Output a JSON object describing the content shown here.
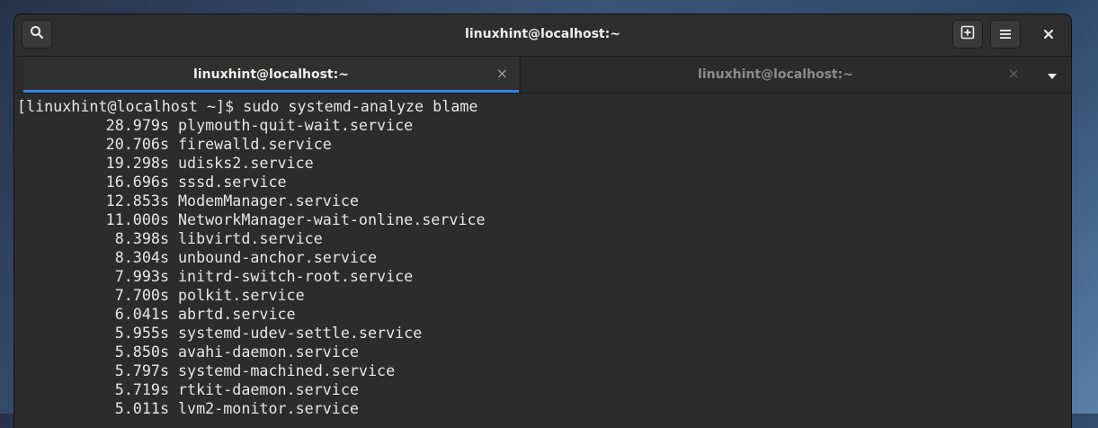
{
  "window": {
    "title": "linuxhint@localhost:~"
  },
  "headerbar": {
    "search_icon": "search-icon",
    "new_tab_icon": "new-tab-icon",
    "menu_icon": "hamburger-menu-icon",
    "close_icon": "close-icon"
  },
  "tabs": [
    {
      "label": "linuxhint@localhost:~",
      "active": true,
      "close": "×"
    },
    {
      "label": "linuxhint@localhost:~",
      "active": false,
      "close": "×"
    }
  ],
  "tab_menu_icon": "chevron-down-icon",
  "terminal": {
    "prompt": "[linuxhint@localhost ~]$ sudo systemd-analyze blame",
    "rows": [
      {
        "time": "28.979s",
        "service": "plymouth-quit-wait.service"
      },
      {
        "time": "20.706s",
        "service": "firewalld.service"
      },
      {
        "time": "19.298s",
        "service": "udisks2.service"
      },
      {
        "time": "16.696s",
        "service": "sssd.service"
      },
      {
        "time": "12.853s",
        "service": "ModemManager.service"
      },
      {
        "time": "11.000s",
        "service": "NetworkManager-wait-online.service"
      },
      {
        "time": "8.398s",
        "service": "libvirtd.service"
      },
      {
        "time": "8.304s",
        "service": "unbound-anchor.service"
      },
      {
        "time": "7.993s",
        "service": "initrd-switch-root.service"
      },
      {
        "time": "7.700s",
        "service": "polkit.service"
      },
      {
        "time": "6.041s",
        "service": "abrtd.service"
      },
      {
        "time": "5.955s",
        "service": "systemd-udev-settle.service"
      },
      {
        "time": "5.850s",
        "service": "avahi-daemon.service"
      },
      {
        "time": "5.797s",
        "service": "systemd-machined.service"
      },
      {
        "time": "5.719s",
        "service": "rtkit-daemon.service"
      },
      {
        "time": "5.011s",
        "service": "lvm2-monitor.service"
      }
    ]
  }
}
